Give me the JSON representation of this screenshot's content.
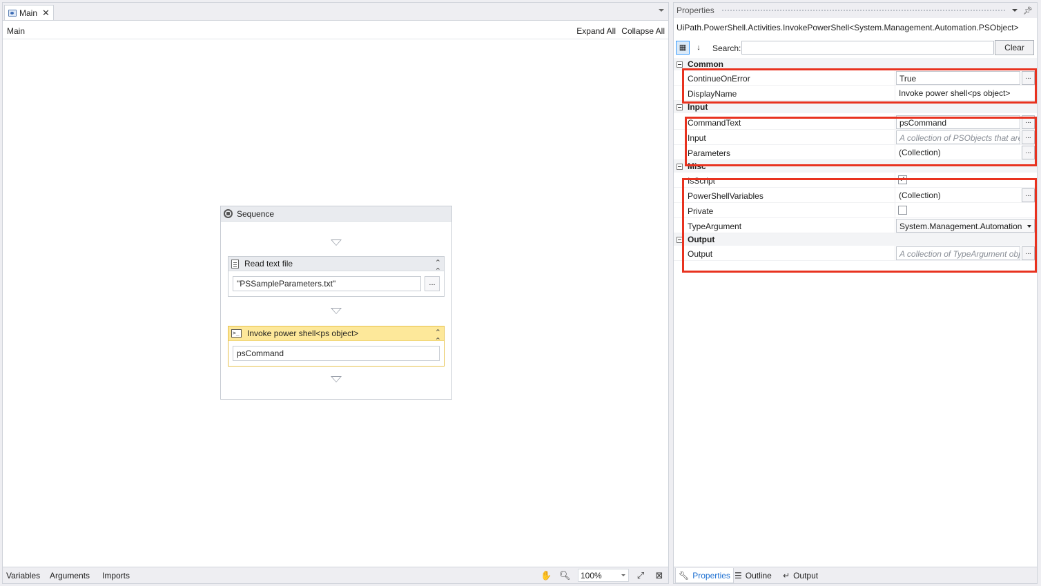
{
  "designer": {
    "tab_label": "Main",
    "breadcrumb": "Main",
    "expand_all": "Expand All",
    "collapse_all": "Collapse All",
    "sequence": {
      "title": "Sequence",
      "activities": [
        {
          "title": "Read text file",
          "value": "\"PSSampleParameters.txt\""
        },
        {
          "title": "Invoke power shell<ps object>",
          "value": "psCommand"
        }
      ]
    },
    "bottom": {
      "variables": "Variables",
      "arguments": "Arguments",
      "imports": "Imports",
      "zoom": "100%"
    }
  },
  "properties": {
    "title": "Properties",
    "type_name": "UiPath.PowerShell.Activities.InvokePowerShell<System.Management.Automation.PSObject>",
    "search_label": "Search:",
    "clear_label": "Clear",
    "categories": {
      "common": {
        "label": "Common",
        "continue_on_error": {
          "name": "ContinueOnError",
          "value": "True"
        },
        "display_name": {
          "name": "DisplayName",
          "value": "Invoke power shell<ps object>"
        }
      },
      "input": {
        "label": "Input",
        "command_text": {
          "name": "CommandText",
          "value": "psCommand"
        },
        "input": {
          "name": "Input",
          "placeholder": "A collection of PSObjects that are"
        },
        "parameters": {
          "name": "Parameters",
          "value": "(Collection)"
        }
      },
      "misc": {
        "label": "Misc",
        "is_script": {
          "name": "IsScript",
          "checked": true
        },
        "powershell_variables": {
          "name": "PowerShellVariables",
          "value": "(Collection)"
        },
        "private": {
          "name": "Private",
          "checked": false
        },
        "type_argument": {
          "name": "TypeArgument",
          "value": "System.Management.Automation"
        }
      },
      "output": {
        "label": "Output",
        "output": {
          "name": "Output",
          "placeholder": "A collection of TypeArgument obj"
        }
      }
    },
    "bottom_tabs": {
      "properties": "Properties",
      "outline": "Outline",
      "output": "Output"
    }
  },
  "colors": {
    "highlight": "#e8321f",
    "selected_activity": "#fde89a",
    "active_tab_text": "#1c6fd1"
  }
}
